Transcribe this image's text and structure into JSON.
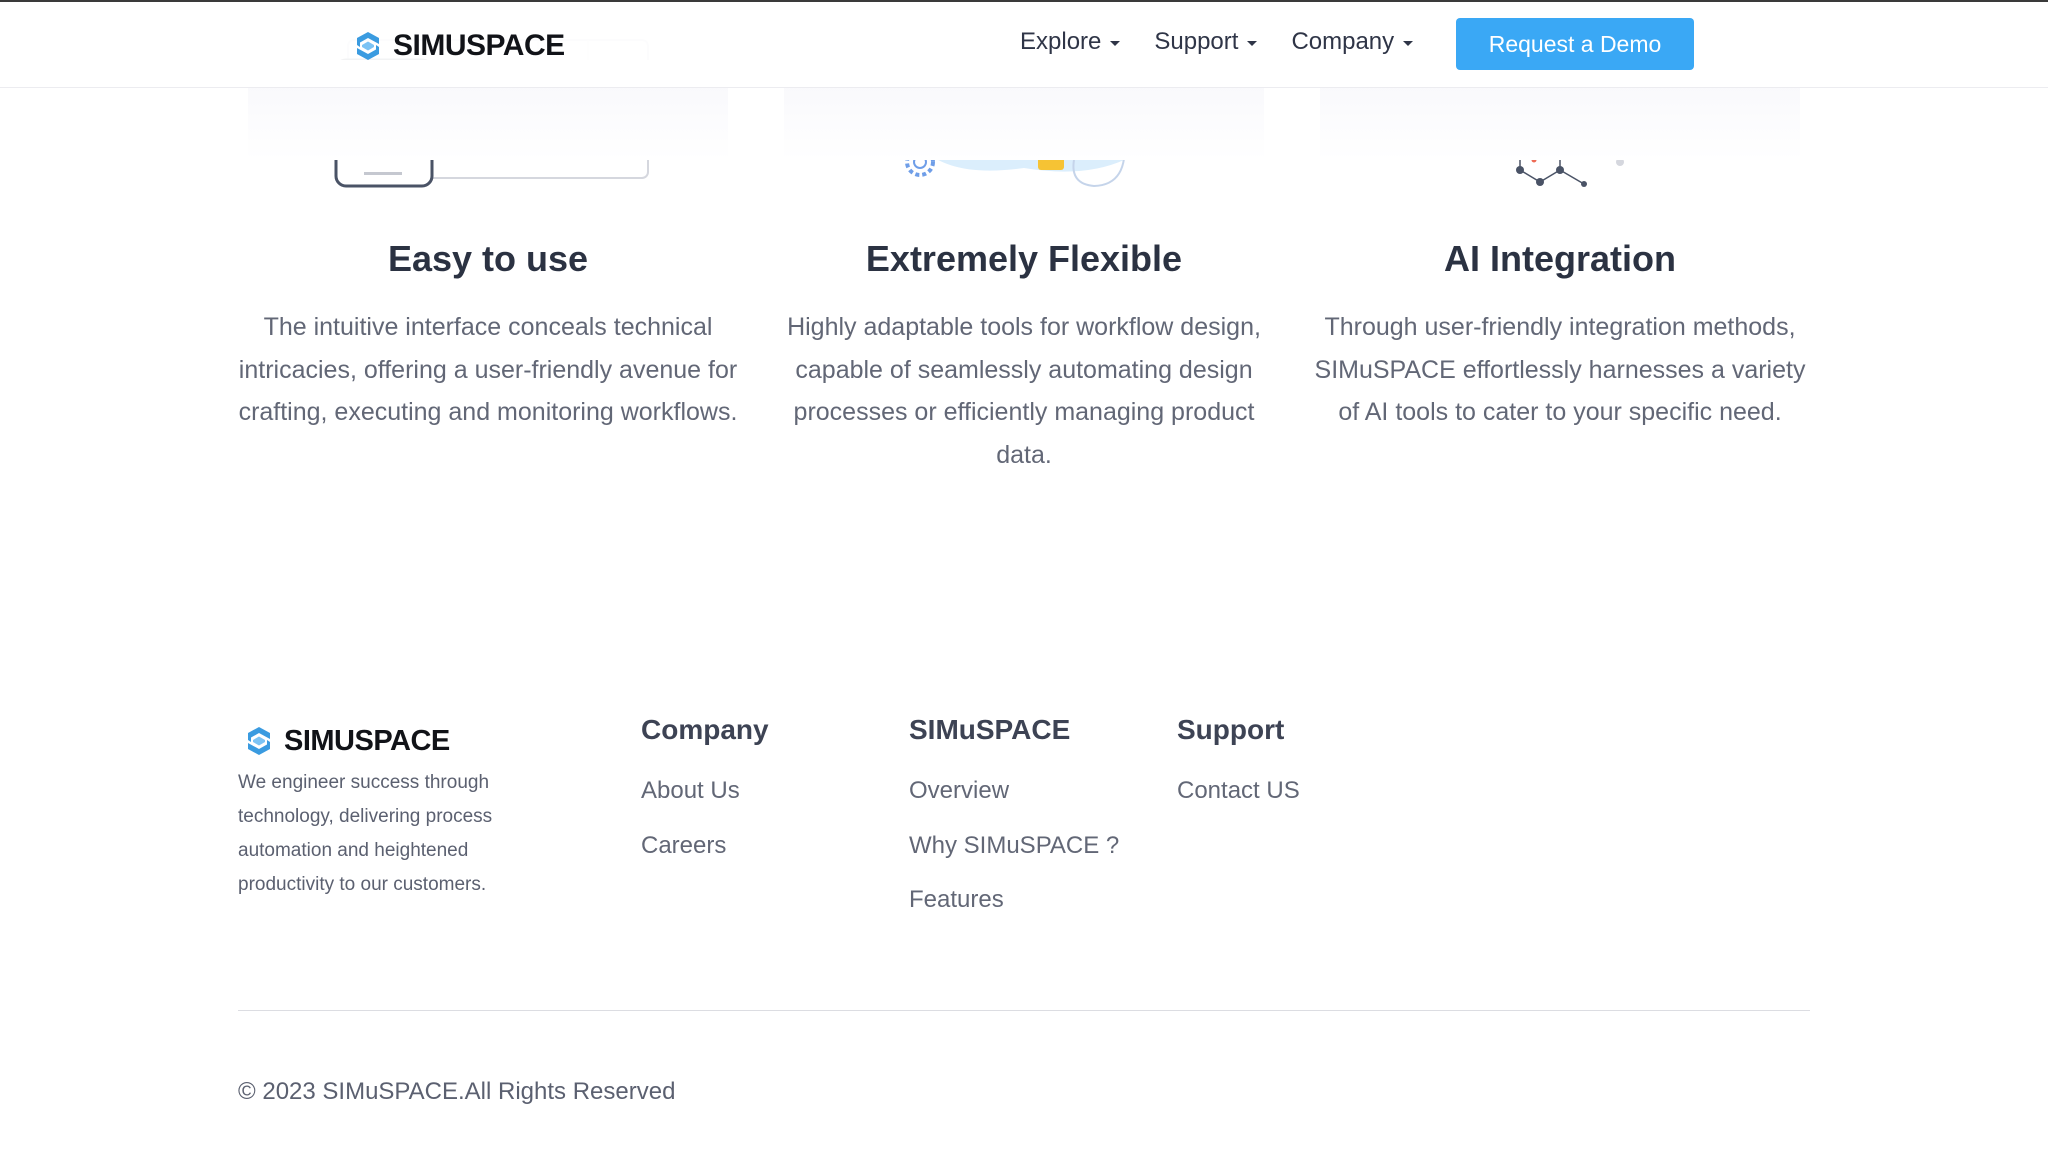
{
  "header": {
    "logo_text": "SIMUSPACE",
    "nav": [
      {
        "label": "Explore"
      },
      {
        "label": "Support"
      },
      {
        "label": "Company"
      }
    ],
    "cta_label": "Request a Demo"
  },
  "features": [
    {
      "title": "Easy to use",
      "description": "The intuitive interface conceals technical intricacies, offering a user-friendly avenue for crafting, executing and monitoring workflows.",
      "illustration": "tablet-phone-illustration"
    },
    {
      "title": "Extremely Flexible",
      "description": "Highly adaptable tools for workflow design, capable of seamlessly automating design processes or efficiently managing product data.",
      "illustration": "laptop-server-illustration"
    },
    {
      "title": "AI Integration",
      "description": "Through user-friendly integration methods, SIMuSPACE effortlessly harnesses a variety of AI tools to cater to your specific need.",
      "illustration": "brain-network-illustration"
    }
  ],
  "footer": {
    "logo_text": "SIMUSPACE",
    "tagline": "We engineer success through technology, delivering process automation and heightened productivity to our customers.",
    "columns": [
      {
        "title": "Company",
        "links": [
          "About Us",
          "Careers"
        ]
      },
      {
        "title": "SIMuSPACE",
        "links": [
          "Overview",
          "Why SIMuSPACE ?",
          "Features"
        ]
      },
      {
        "title": "Support",
        "links": [
          "Contact US"
        ]
      }
    ],
    "copyright": "© 2023 SIMuSPACE.All Rights Reserved"
  },
  "colors": {
    "accent": "#3aa8f5",
    "logo_blue": "#3a9be0",
    "heading": "#2b3242",
    "body_text": "#626776",
    "brain": "#ee6b55"
  }
}
